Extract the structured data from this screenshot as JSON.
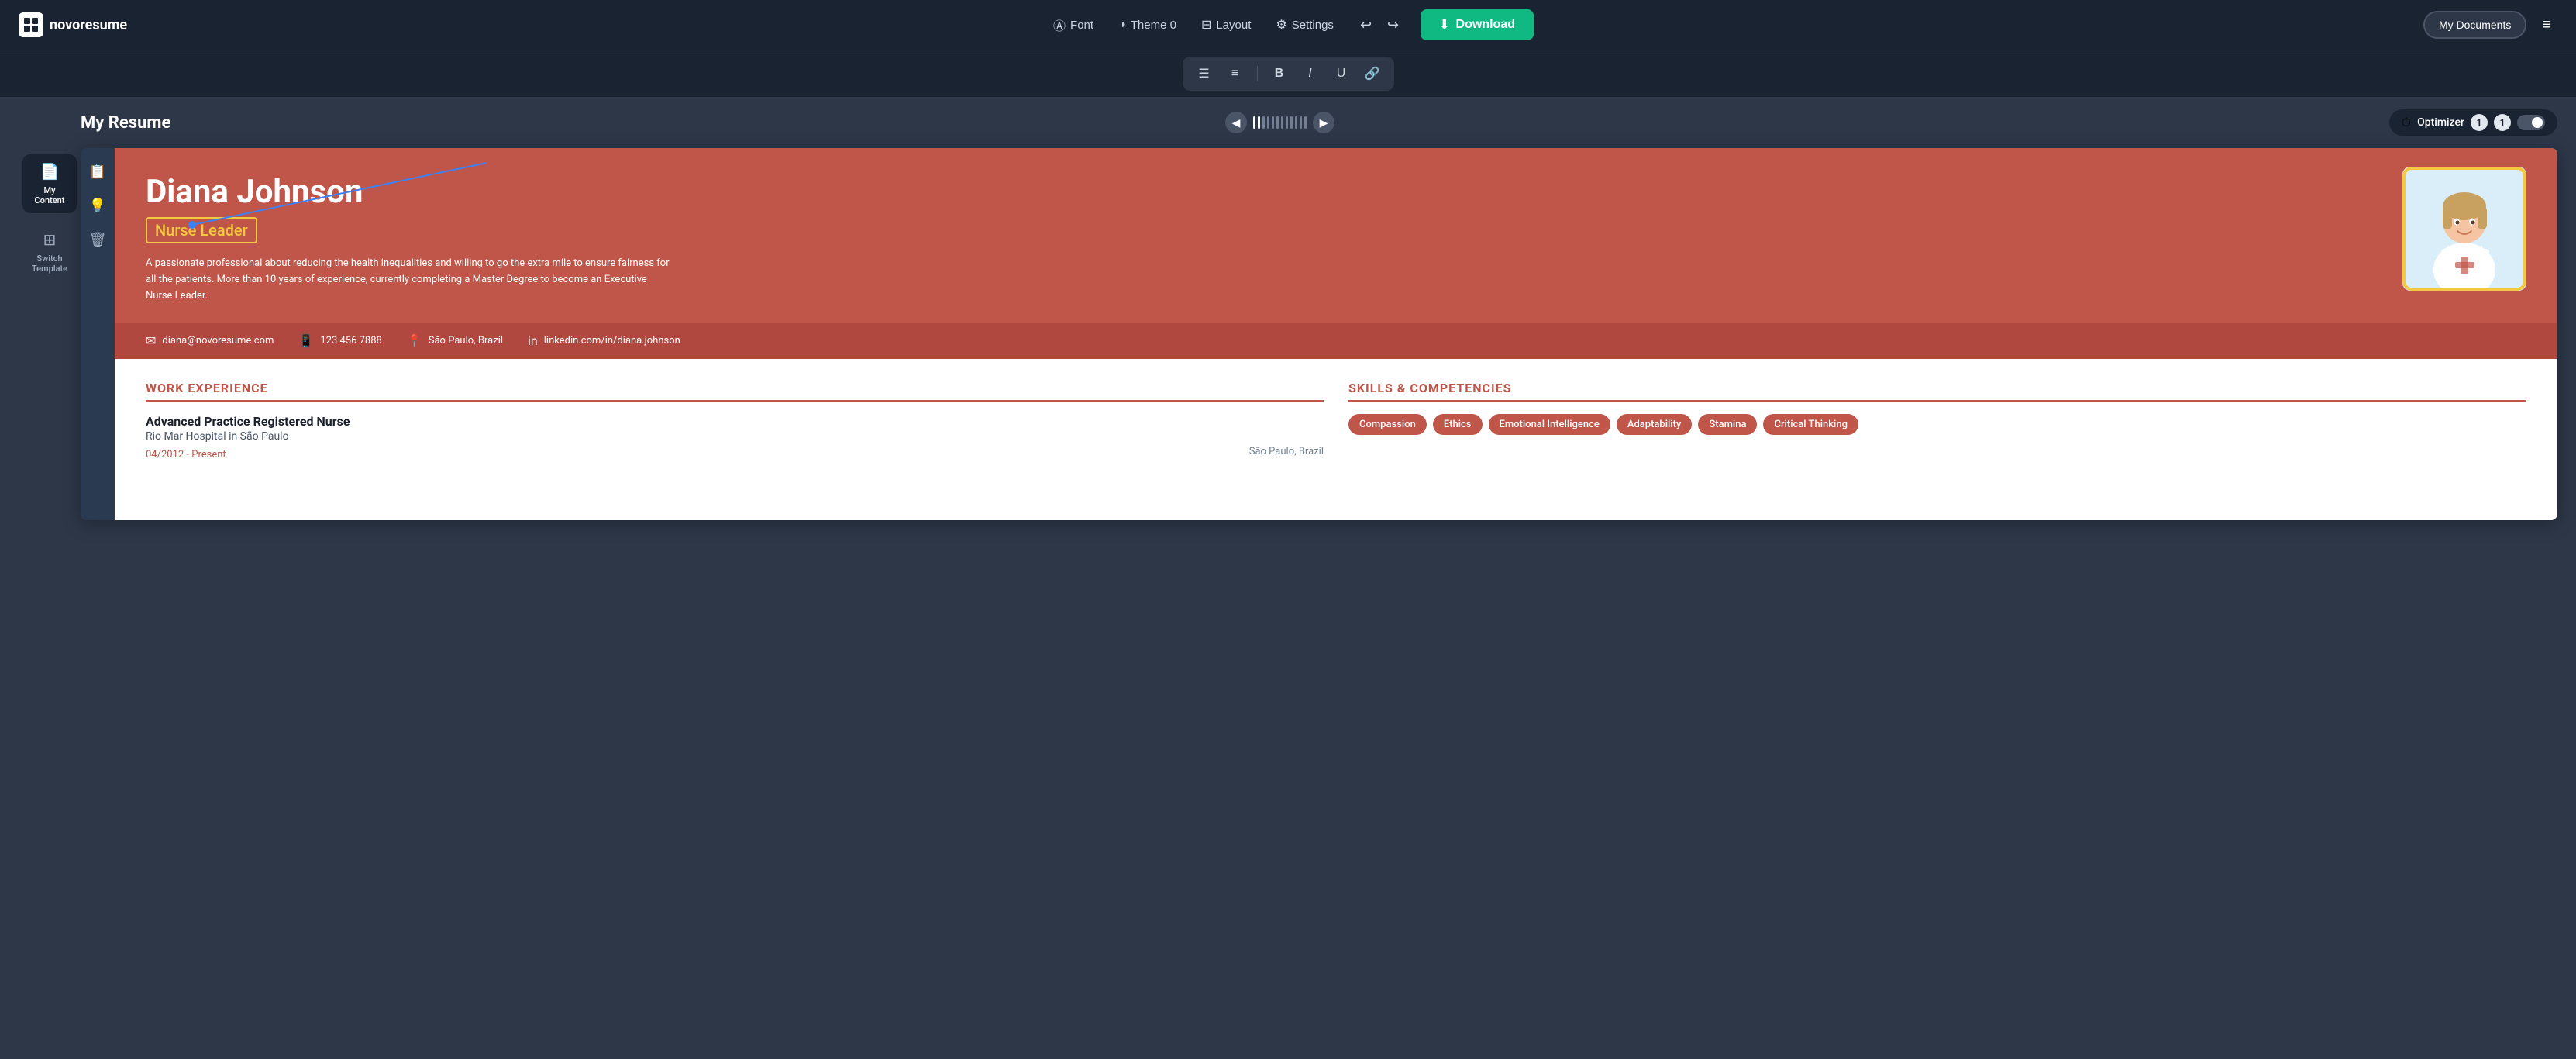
{
  "app": {
    "logo_text": "novoresume",
    "logo_icon": "N"
  },
  "top_nav": {
    "font_label": "Font",
    "theme_label": "Theme 0",
    "layout_label": "Layout",
    "settings_label": "Settings",
    "download_label": "Download",
    "my_docs_label": "My Documents"
  },
  "format_bar": {
    "align_left": "≡",
    "align_center": "≡",
    "bold": "B",
    "italic": "I",
    "underline": "U",
    "link": "⌁"
  },
  "doc_header": {
    "title": "My Resume",
    "optimizer_label": "Optimizer",
    "optimizer_badge1": "1",
    "optimizer_badge2": "1"
  },
  "left_sidebar": {
    "items": [
      {
        "id": "my-content",
        "label": "My Content",
        "icon": "📄"
      },
      {
        "id": "switch-template",
        "label": "Switch Template",
        "icon": "⊞"
      }
    ]
  },
  "inner_sidebar": {
    "buttons": [
      {
        "id": "template",
        "icon": "📋"
      },
      {
        "id": "lightbulb",
        "icon": "💡"
      },
      {
        "id": "trash",
        "icon": "🗑"
      }
    ]
  },
  "resume": {
    "name": "Diana Johnson",
    "title": "Nurse Leader",
    "summary": "A passionate professional about reducing the health inequalities and willing to go the extra mile to ensure fairness for all the patients. More than 10 years of experience, currently completing a Master Degree to become an Executive Nurse Leader.",
    "contact": {
      "email": "diana@novoresume.com",
      "phone": "123 456 7888",
      "location": "São Paulo, Brazil",
      "linkedin": "linkedin.com/in/diana.johnson"
    },
    "work_experience": {
      "section_title": "WORK EXPERIENCE",
      "jobs": [
        {
          "title": "Advanced Practice Registered Nurse",
          "company": "Rio Mar Hospital in São Paulo",
          "date": "04/2012 - Present",
          "location": "São Paulo, Brazil"
        }
      ]
    },
    "skills": {
      "section_title": "SKILLS & COMPETENCIES",
      "items": [
        "Compassion",
        "Ethics",
        "Emotional Intelligence",
        "Adaptability",
        "Stamina",
        "Critical Thinking"
      ]
    }
  }
}
